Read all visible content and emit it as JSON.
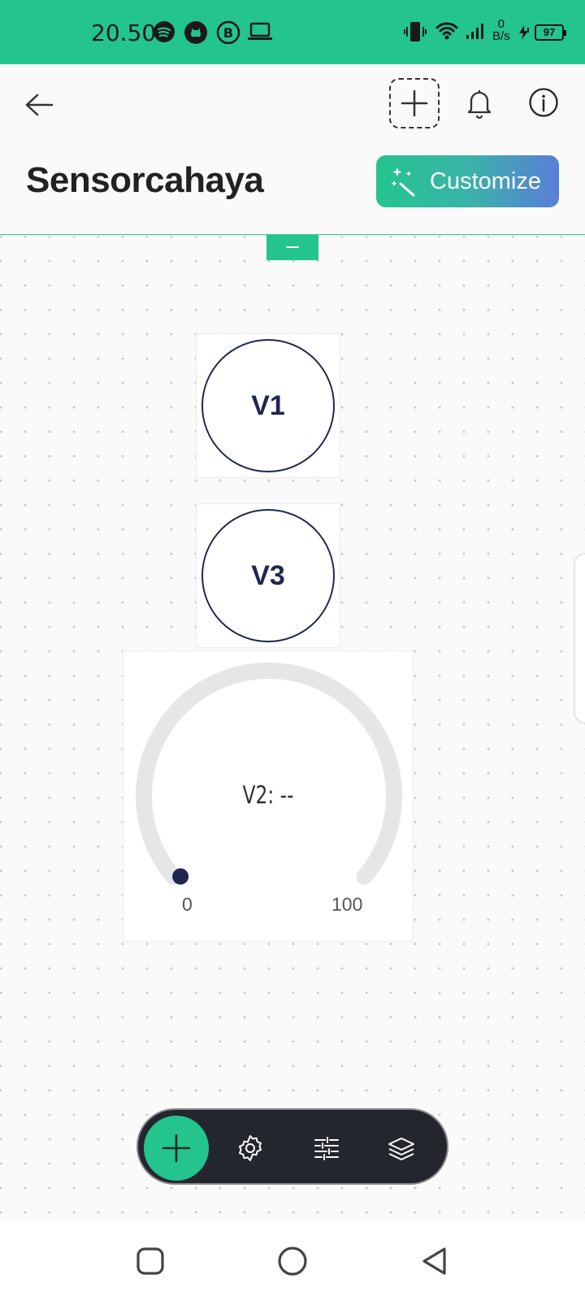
{
  "status_bar": {
    "time": "20.50",
    "net_speed_value": "0",
    "net_speed_unit": "B/s",
    "battery": "97",
    "icons": [
      "spotify-icon",
      "github-icon",
      "b-circle-icon",
      "laptop-icon",
      "vibrate-icon",
      "wifi-icon",
      "signal-icon",
      "charging-icon"
    ]
  },
  "header": {
    "title": "Sensorcahaya",
    "customize_label": "Customize",
    "icons": [
      "back-arrow-icon",
      "add-widget-icon",
      "bell-icon",
      "info-icon"
    ]
  },
  "widgets": {
    "led_v1": {
      "label": "V1"
    },
    "led_v3": {
      "label": "V3"
    },
    "gauge_v2": {
      "label": "V2: --",
      "min": "0",
      "max": "100",
      "value_fraction": 0
    }
  },
  "toolbar": {
    "icons": [
      "plus-icon",
      "gear-icon",
      "sliders-icon",
      "layers-icon"
    ]
  },
  "navbar": {
    "icons": [
      "recents-square-icon",
      "home-circle-icon",
      "back-triangle-icon"
    ]
  },
  "colors": {
    "accent": "#24c48e",
    "widget_ink": "#22264f",
    "toolbar_bg": "#24262e",
    "gradient_end": "#5b7ed8"
  }
}
